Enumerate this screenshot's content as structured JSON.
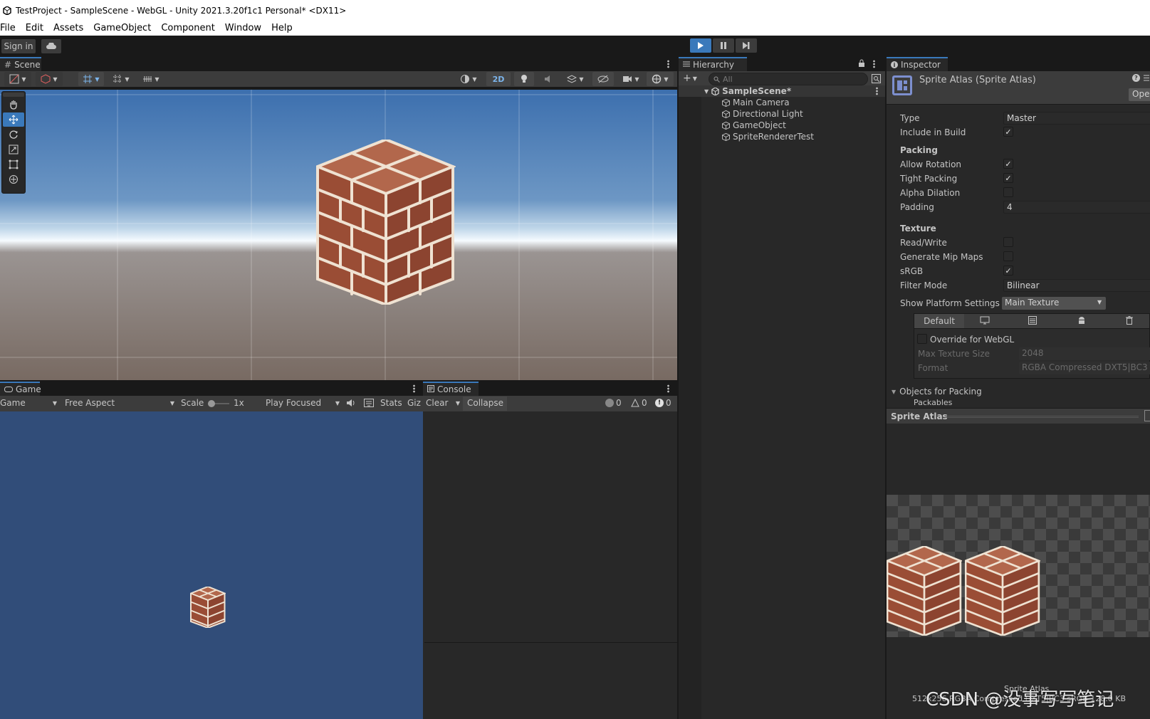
{
  "window": {
    "title": "TestProject - SampleScene - WebGL - Unity 2021.3.20f1c1 Personal* <DX11>"
  },
  "menu": [
    "File",
    "Edit",
    "Assets",
    "GameObject",
    "Component",
    "Window",
    "Help"
  ],
  "toolbar": {
    "sign_in": "Sign in"
  },
  "scene": {
    "tab": "Scene",
    "mode_2d": "2D"
  },
  "hierarchy": {
    "tab": "Hierarchy",
    "search_placeholder": "All",
    "scene_name": "SampleScene*",
    "items": [
      "Main Camera",
      "Directional Light",
      "GameObject",
      "SpriteRendererTest"
    ]
  },
  "inspector": {
    "tab": "Inspector",
    "header": "Sprite Atlas (Sprite Atlas)",
    "open_button": "Ope",
    "type_label": "Type",
    "type_value": "Master",
    "include_label": "Include in Build",
    "packing_title": "Packing",
    "allow_rotation": "Allow Rotation",
    "tight_packing": "Tight Packing",
    "alpha_dilation": "Alpha Dilation",
    "padding_label": "Padding",
    "padding_value": "4",
    "texture_title": "Texture",
    "read_write": "Read/Write",
    "mipmaps": "Generate Mip Maps",
    "srgb": "sRGB",
    "filter_label": "Filter Mode",
    "filter_value": "Bilinear",
    "platform_label": "Show Platform Settings F",
    "platform_value": "Main Texture",
    "platform_default": "Default",
    "override_label": "Override for WebGL",
    "max_size_label": "Max Texture Size",
    "max_size_value": "2048",
    "format_label": "Format",
    "format_value": "RGBA Compressed DXT5|BC3",
    "objects_title": "Objects for Packing",
    "packables": "Packables",
    "preview_title": "Sprite Atlas",
    "preview_name": "Sprite Atlas",
    "preview_info": "512x256 RGBA Compressed DXT5|BC3 sRGB  128.0 KB"
  },
  "game": {
    "tab": "Game",
    "display": "Game",
    "aspect": "Free Aspect",
    "scale_label": "Scale",
    "scale_value": "1x",
    "play_mode": "Play Focused",
    "stats": "Stats",
    "gizmos": "Giz"
  },
  "console": {
    "tab": "Console",
    "clear": "Clear",
    "collapse": "Collapse",
    "log_count": "0",
    "warn_count": "0",
    "error_count": "0"
  },
  "watermark": "CSDN @没事写写笔记",
  "colors": {
    "accent": "#3a79bb",
    "game_bg": "#314d79",
    "panel": "#282828"
  }
}
